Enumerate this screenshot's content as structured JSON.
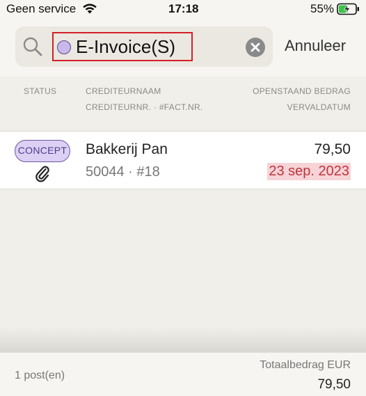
{
  "status_bar": {
    "carrier": "Geen service",
    "time": "17:18",
    "battery_percent": "55%",
    "battery_level": 0.55
  },
  "search": {
    "token_label": "E-Invoice(S)",
    "token_color": "#c9b8ec",
    "cancel_label": "Annuleer"
  },
  "columns": {
    "status": "STATUS",
    "creditor_name": "CREDITEURNAAM",
    "creditor_nr": "CREDITEURNR. · #FACT.NR.",
    "outstanding_amount": "OPENSTAAND BEDRAG",
    "due_date": "VERVALDATUM"
  },
  "rows": [
    {
      "status": "CONCEPT",
      "has_attachment": true,
      "creditor_name": "Bakkerij Pan",
      "creditor_nr": "50044 · #18",
      "amount": "79,50",
      "due_date": "23 sep. 2023",
      "due_overdue": true
    }
  ],
  "footer": {
    "count": "1 post(en)",
    "total_label": "Totaalbedrag EUR",
    "total": "79,50"
  },
  "colors": {
    "accent_highlight": "#d41f26",
    "status_badge": "#ddd0f5",
    "overdue_text": "#c0343f",
    "overdue_bg": "#f6d3d6"
  }
}
